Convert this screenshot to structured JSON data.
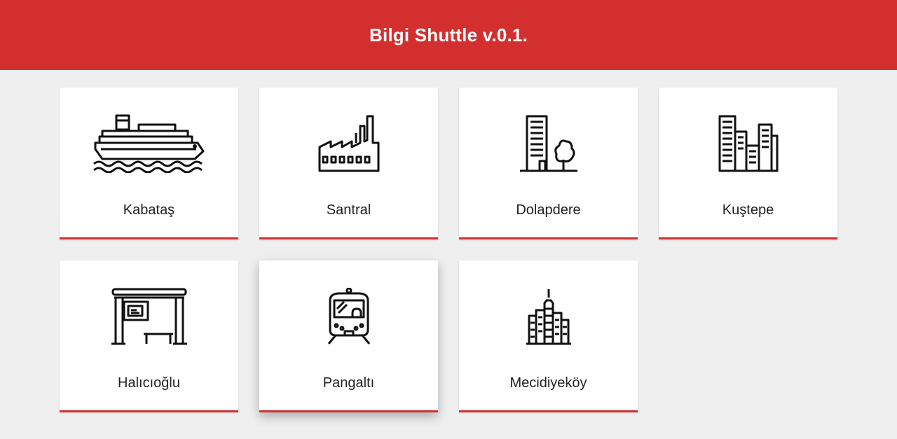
{
  "header": {
    "title": "Bilgi Shuttle v.0.1."
  },
  "accent_color": "#d32f2f",
  "stops": [
    {
      "label": "Kabataş",
      "icon": "ship-icon"
    },
    {
      "label": "Santral",
      "icon": "factory-icon"
    },
    {
      "label": "Dolapdere",
      "icon": "building-tree-icon"
    },
    {
      "label": "Kuştepe",
      "icon": "city-buildings-icon"
    },
    {
      "label": "Halıcıoğlu",
      "icon": "bus-stop-icon"
    },
    {
      "label": "Pangaltı",
      "icon": "train-icon"
    },
    {
      "label": "Mecidiyeköy",
      "icon": "skyscrapers-icon"
    }
  ]
}
